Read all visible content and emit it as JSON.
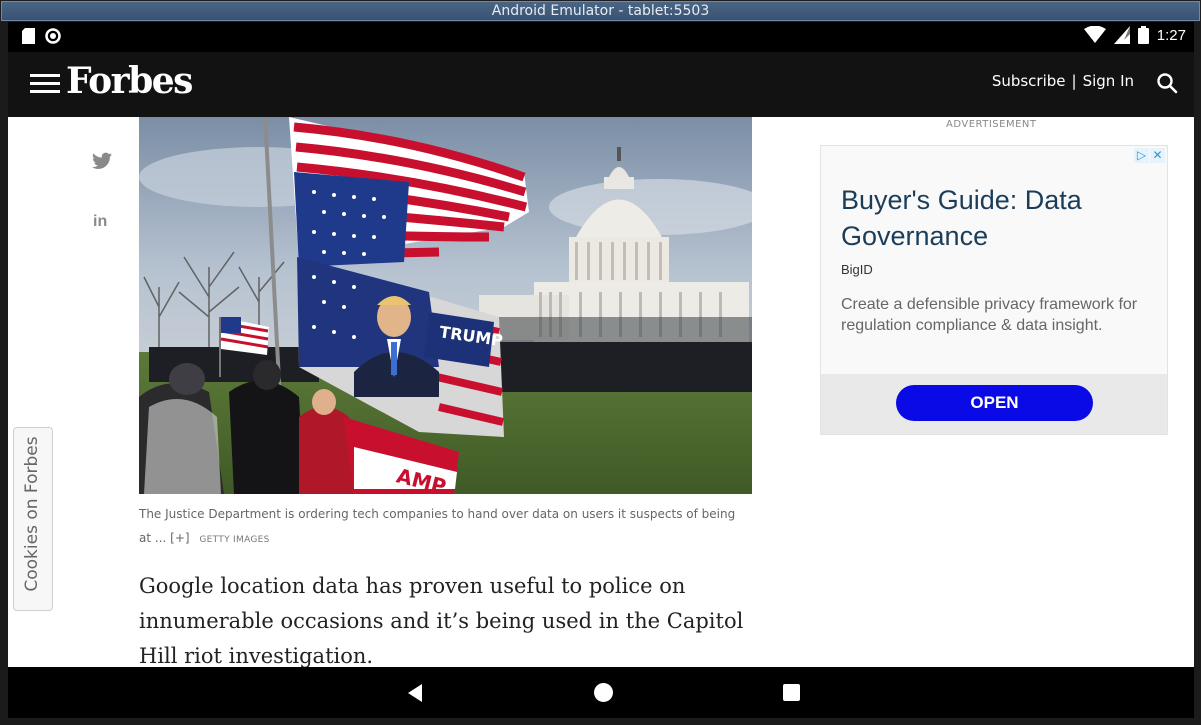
{
  "window": {
    "title": "Android Emulator - tablet:5503"
  },
  "status_bar": {
    "time": "1:27"
  },
  "header": {
    "logo": "Forbes",
    "subscribe_label": "Subscribe",
    "separator": "|",
    "signin_label": "Sign In"
  },
  "share": {
    "linkedin_label": "in"
  },
  "cookies_tab": {
    "label": "Cookies on Forbes"
  },
  "article": {
    "caption": "The Justice Department is ordering tech companies to hand over data on users it suspects of being at ...",
    "caption_expand": "[+]",
    "credit": "GETTY IMAGES",
    "paragraph": "Google location data has proven useful to police on innumerable occasions and it’s being used in the Capitol Hill riot investigation.",
    "image_text": {
      "flag_text": "TRUMP",
      "banner_text": "AMP"
    }
  },
  "ad": {
    "label": "ADVERTISEMENT",
    "title": "Buyer's Guide: Data Governance",
    "brand": "BigID",
    "description": "Create a defensible privacy framework for regulation compliance & data insight.",
    "button_label": "OPEN"
  },
  "colors": {
    "header_bg": "#121212",
    "ad_button": "#0a0ae6",
    "ad_title": "#1c3d5a"
  }
}
